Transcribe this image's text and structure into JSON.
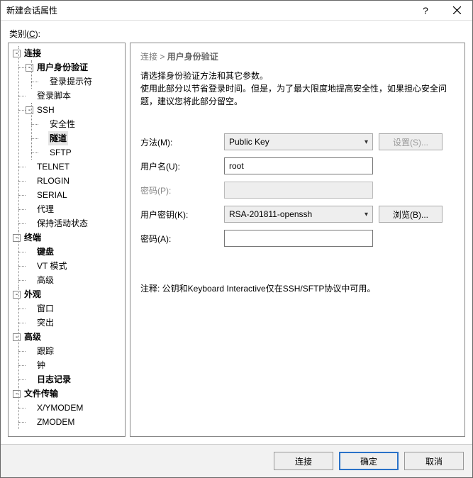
{
  "window": {
    "title": "新建会话属性"
  },
  "category_label": "类别(C):",
  "tree": {
    "connection": "连接",
    "auth": "用户身份验证",
    "login_prompt": "登录提示符",
    "login_script": "登录脚本",
    "ssh": "SSH",
    "security": "安全性",
    "tunnel": "隧道",
    "sftp": "SFTP",
    "telnet": "TELNET",
    "rlogin": "RLOGIN",
    "serial": "SERIAL",
    "proxy": "代理",
    "keepalive": "保持活动状态",
    "terminal": "终端",
    "keyboard": "键盘",
    "vtmode": "VT 模式",
    "advanced1": "高级",
    "appearance": "外观",
    "window": "窗口",
    "highlight": "突出",
    "advanced": "高级",
    "trace": "跟踪",
    "clock": "钟",
    "logging": "日志记录",
    "filetrans": "文件传输",
    "xymodem": "X/YMODEM",
    "zmodem": "ZMODEM"
  },
  "breadcrumb": {
    "parent": "连接",
    "sep": ">",
    "current": "用户身份验证"
  },
  "desc": {
    "line1": "请选择身份验证方法和其它参数。",
    "line2": "使用此部分以节省登录时间。但是，为了最大限度地提高安全性，如果担心安全问题，建议您将此部分留空。"
  },
  "form": {
    "method_label": "方法(M):",
    "method_value": "Public Key",
    "settings_btn": "设置(S)...",
    "user_label": "用户名(U):",
    "user_value": "root",
    "password_label": "密码(P):",
    "userkey_label": "用户密钥(K):",
    "userkey_value": "RSA-201811-openssh",
    "browse_btn": "浏览(B)...",
    "passphrase_label": "密码(A):"
  },
  "note": "注释: 公钥和Keyboard Interactive仅在SSH/SFTP协议中可用。",
  "footer": {
    "connect": "连接",
    "ok": "确定",
    "cancel": "取消"
  }
}
